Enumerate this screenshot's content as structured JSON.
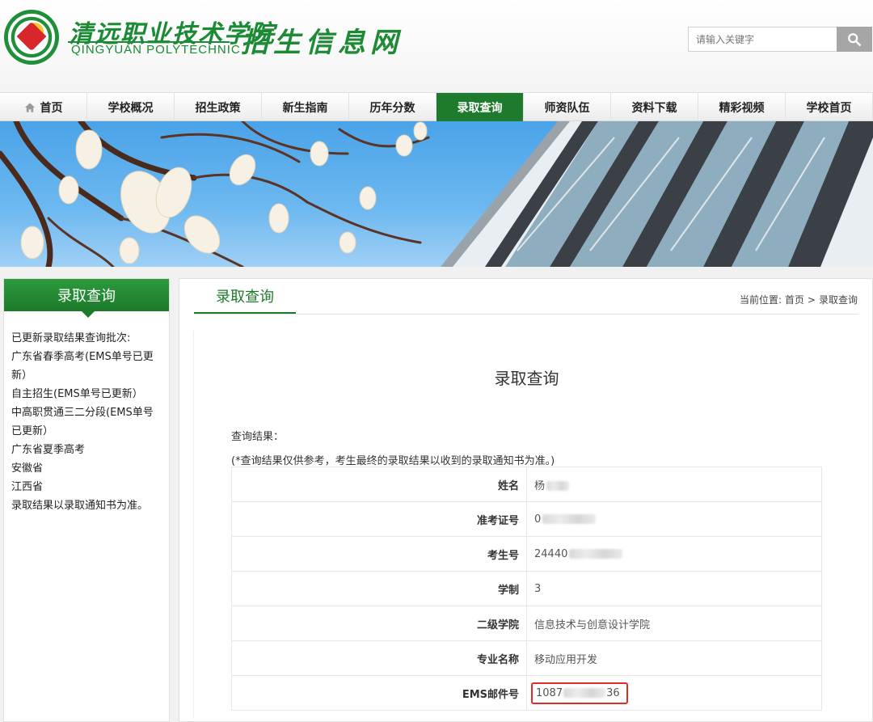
{
  "header": {
    "school_name_cn": "清远职业技术学院",
    "school_name_en": "QINGYUAN  POLYTECHNIC",
    "site_title": "招生信息网",
    "search": {
      "placeholder": "请输入关键字"
    }
  },
  "nav": {
    "items": [
      {
        "label": "首页",
        "icon": "home-icon"
      },
      {
        "label": "学校概况"
      },
      {
        "label": "招生政策"
      },
      {
        "label": "新生指南"
      },
      {
        "label": "历年分数"
      },
      {
        "label": "录取查询",
        "active": true
      },
      {
        "label": "师资队伍"
      },
      {
        "label": "资料下载"
      },
      {
        "label": "精彩视频"
      },
      {
        "label": "学校首页"
      }
    ],
    "active_color": "#1e7a2c"
  },
  "sidebar": {
    "title": "录取查询",
    "lines": [
      "已更新录取结果查询批次:",
      "广东省春季高考(EMS单号已更新）",
      "自主招生(EMS单号已更新）",
      "中高职贯通三二分段(EMS单号已更新）",
      "广东省夏季高考",
      "安徽省",
      "江西省",
      "录取结果以录取通知书为准。"
    ]
  },
  "main": {
    "tab_title": "录取查询",
    "breadcrumb": {
      "prefix": "当前位置:",
      "home": "首页",
      "sep": ">",
      "current": "录取查询"
    },
    "form_title": "录取查询",
    "result_label": "查询结果：",
    "result_note": "(*查询结果仅供参考，考生最终的录取结果以收到的录取通知书为准。)",
    "rows": [
      {
        "key": "姓名",
        "value": "杨"
      },
      {
        "key": "准考证号",
        "value": "0"
      },
      {
        "key": "考生号",
        "value": "24440"
      },
      {
        "key": "学制",
        "value": "3"
      },
      {
        "key": "二级学院",
        "value": "信息技术与创意设计学院"
      },
      {
        "key": "专业名称",
        "value": "移动应用开发"
      },
      {
        "key": "EMS邮件号",
        "value": "1087",
        "value_suffix": "36"
      }
    ],
    "highlight_color": "#e12a2a"
  }
}
